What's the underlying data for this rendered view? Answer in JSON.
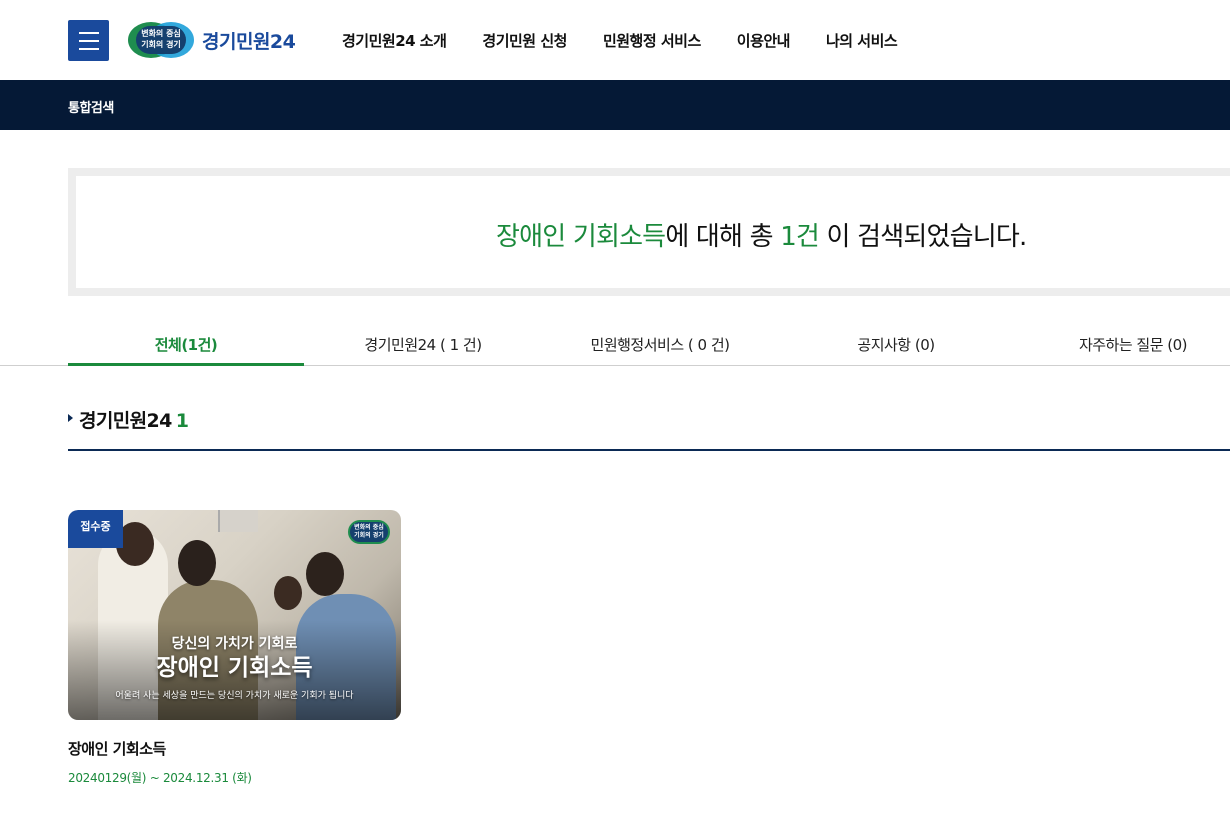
{
  "header": {
    "logo_badge_line1": "변화의 중심",
    "logo_badge_line2": "기회의 경기",
    "logo_text": "경기민원24",
    "nav": [
      {
        "label": "경기민원24 소개"
      },
      {
        "label": "경기민원 신청"
      },
      {
        "label": "민원행정 서비스"
      },
      {
        "label": "이용안내"
      },
      {
        "label": "나의 서비스"
      }
    ]
  },
  "subbar": {
    "title": "통합검색"
  },
  "result": {
    "keyword": "장애인 기회소득",
    "text_mid": "에 대해 총 ",
    "count": "1건",
    "text_end": " 이 검색되었습니다."
  },
  "tabs": [
    {
      "label": "전체(1건)",
      "active": true
    },
    {
      "label": "경기민원24 ( 1 건)"
    },
    {
      "label": "민원행정서비스 ( 0 건)"
    },
    {
      "label": "공지사항 (0)"
    },
    {
      "label": "자주하는 질문 (0)"
    }
  ],
  "section": {
    "name": "경기민원24",
    "count": "1"
  },
  "card": {
    "badge": "접수중",
    "mini_logo_line1": "변화의 중심",
    "mini_logo_line2": "기회의 경기",
    "overlay_subtitle": "당신의 가치가 기회로",
    "overlay_title": "장애인 기회소득",
    "overlay_desc": "어울려 사는 세상을 만드는 당신의 가치가 새로운 기회가 됩니다",
    "title": "장애인 기회소득",
    "date": "20240129(월) ~ 2024.12.31 (화)"
  },
  "colors": {
    "brand_blue": "#1a4a9c",
    "navy": "#051936",
    "green": "#1b8a3c"
  }
}
